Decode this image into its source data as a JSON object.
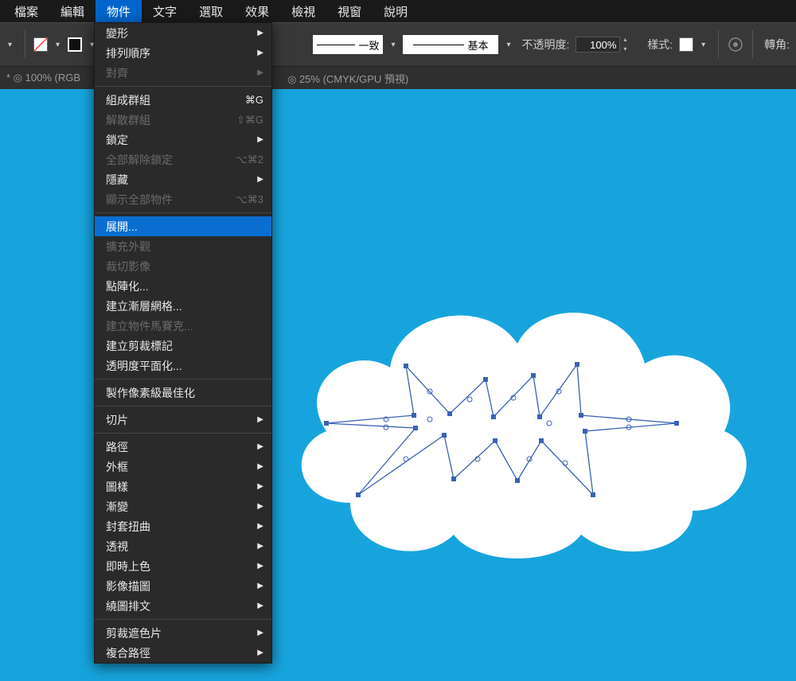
{
  "menubar": [
    "檔案",
    "編輯",
    "物件",
    "文字",
    "選取",
    "效果",
    "檢視",
    "視窗",
    "說明"
  ],
  "menubar_active_index": 2,
  "toolbar": {
    "stroke_label_a": "一致",
    "stroke_label_b": "基本",
    "opacity_label": "不透明度:",
    "opacity_value": "100%",
    "style_label": "樣式:",
    "rotate_label": "轉角:"
  },
  "secondary": {
    "left": "* ◎ 100% (RGB",
    "right": "◎ 25% (CMYK/GPU 預視)"
  },
  "dropdown": [
    {
      "t": "item",
      "label": "變形",
      "sub": true
    },
    {
      "t": "item",
      "label": "排列順序",
      "sub": true
    },
    {
      "t": "item",
      "label": "對齊",
      "sub": true,
      "disabled": true
    },
    {
      "t": "sep"
    },
    {
      "t": "item",
      "label": "組成群組",
      "sc": "⌘G"
    },
    {
      "t": "item",
      "label": "解散群組",
      "sc": "⇧⌘G",
      "disabled": true
    },
    {
      "t": "item",
      "label": "鎖定",
      "sub": true
    },
    {
      "t": "item",
      "label": "全部解除鎖定",
      "sc": "⌥⌘2",
      "disabled": true
    },
    {
      "t": "item",
      "label": "隱藏",
      "sub": true
    },
    {
      "t": "item",
      "label": "顯示全部物件",
      "sc": "⌥⌘3",
      "disabled": true
    },
    {
      "t": "sep"
    },
    {
      "t": "item",
      "label": "展開...",
      "highlight": true
    },
    {
      "t": "item",
      "label": "擴充外觀",
      "disabled": true
    },
    {
      "t": "item",
      "label": "裁切影像",
      "disabled": true
    },
    {
      "t": "item",
      "label": "點陣化..."
    },
    {
      "t": "item",
      "label": "建立漸層網格..."
    },
    {
      "t": "item",
      "label": "建立物件馬賽克...",
      "disabled": true
    },
    {
      "t": "item",
      "label": "建立剪裁標記"
    },
    {
      "t": "item",
      "label": "透明度平面化..."
    },
    {
      "t": "sep"
    },
    {
      "t": "item",
      "label": "製作像素級最佳化"
    },
    {
      "t": "sep"
    },
    {
      "t": "item",
      "label": "切片",
      "sub": true
    },
    {
      "t": "sep"
    },
    {
      "t": "item",
      "label": "路徑",
      "sub": true
    },
    {
      "t": "item",
      "label": "外框",
      "sub": true
    },
    {
      "t": "item",
      "label": "圖樣",
      "sub": true
    },
    {
      "t": "item",
      "label": "漸變",
      "sub": true
    },
    {
      "t": "item",
      "label": "封套扭曲",
      "sub": true
    },
    {
      "t": "item",
      "label": "透視",
      "sub": true
    },
    {
      "t": "item",
      "label": "即時上色",
      "sub": true
    },
    {
      "t": "item",
      "label": "影像描圖",
      "sub": true
    },
    {
      "t": "item",
      "label": "繞圖排文",
      "sub": true
    },
    {
      "t": "sep"
    },
    {
      "t": "item",
      "label": "剪裁遮色片",
      "sub": true
    },
    {
      "t": "item",
      "label": "複合路徑",
      "sub": true
    }
  ]
}
